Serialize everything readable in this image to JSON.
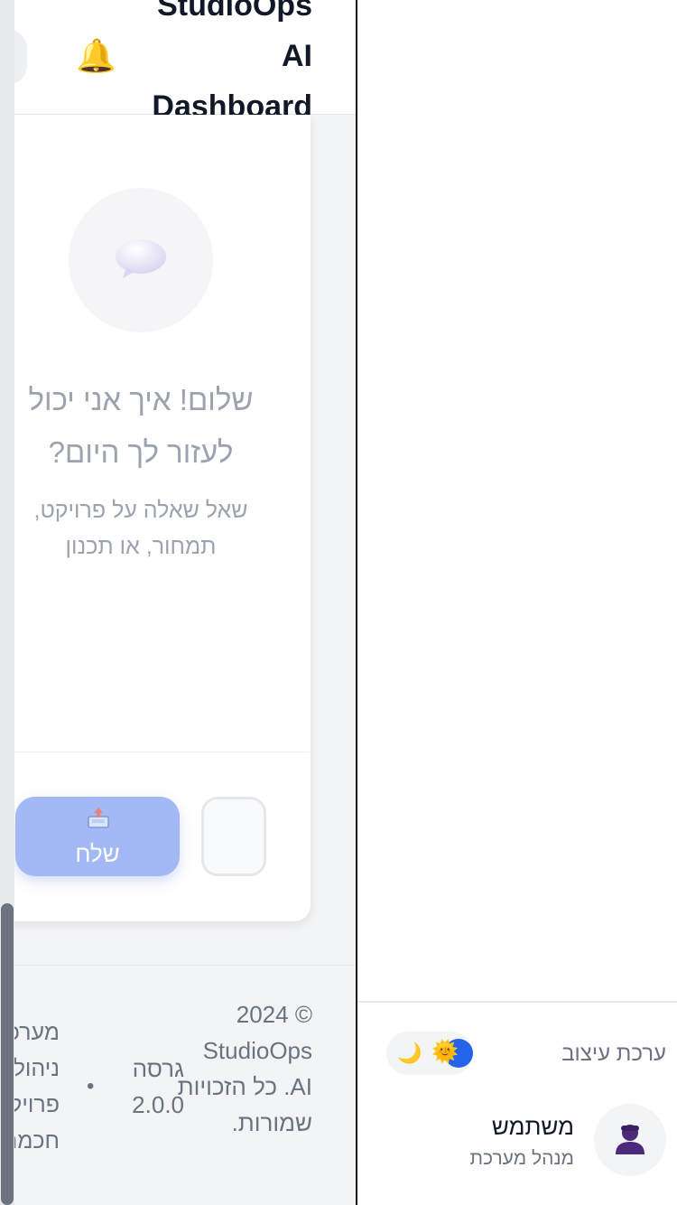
{
  "header": {
    "title": "StudioOps AI Dashboard",
    "notification_icon": "bell-icon"
  },
  "chat": {
    "empty_icon": "speech-bubble-icon",
    "greeting": "שלום! איך אני יכול לעזור לך היום?",
    "subtitle": "שאל שאלה על פרויקט, תמחור, או תכנון",
    "send_label": "שלח",
    "send_icon": "outbox-tray-icon",
    "input_value": ""
  },
  "footer": {
    "copyright": "© 2024 StudioOps AI. כל הזכויות שמורות.",
    "version": "גרסה 2.0.0",
    "separator": "•",
    "tagline": "מערכת ניהול פרויקטים חכמה"
  },
  "sidebar": {
    "theme_label": "ערכת עיצוב",
    "theme_icons": [
      "moon-icon",
      "sun-icon"
    ],
    "user": {
      "name": "משתמש",
      "role": "מנהל מערכת",
      "avatar_icon": "user-silhouette-icon"
    }
  },
  "colors": {
    "accent": "#2563eb",
    "send_button": "#a3b9f5",
    "muted_text": "#9ca3af",
    "scroll_thumb": "#6b7280"
  }
}
